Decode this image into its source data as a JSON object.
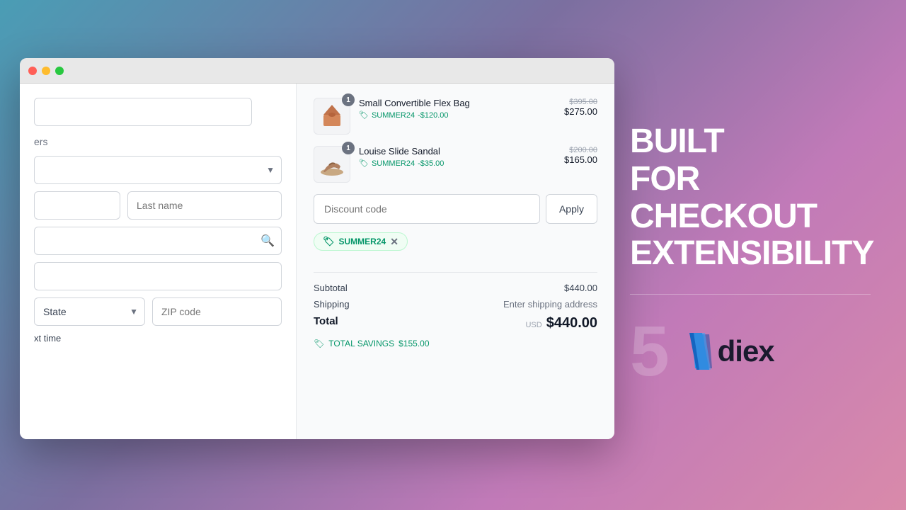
{
  "browser": {
    "traffic_lights": [
      "red",
      "yellow",
      "green"
    ]
  },
  "left_panel": {
    "input_placeholder_1": "",
    "section_label": "ers",
    "dropdown_placeholder": "",
    "first_name_placeholder": "",
    "last_name_placeholder": "Last name",
    "address_placeholder": "",
    "city_placeholder": "",
    "state_label": "State",
    "zip_placeholder": "ZIP code",
    "remember_label": "xt time"
  },
  "right_panel": {
    "items": [
      {
        "name": "Small Convertible Flex Bag",
        "badge": "1",
        "discount_code": "SUMMER24",
        "discount_amount": "-$120.00",
        "original_price": "$395.00",
        "sale_price": "$275.00"
      },
      {
        "name": "Louise Slide Sandal",
        "badge": "1",
        "discount_code": "SUMMER24",
        "discount_amount": "-$35.00",
        "original_price": "$200.00",
        "sale_price": "$165.00"
      }
    ],
    "discount_input_placeholder": "Discount code",
    "apply_button": "Apply",
    "applied_code": "SUMMER24",
    "subtotal_label": "Subtotal",
    "subtotal_value": "$440.00",
    "shipping_label": "Shipping",
    "shipping_value": "Enter shipping address",
    "total_label": "Total",
    "total_currency": "USD",
    "total_value": "$440.00",
    "savings_label": "TOTAL SAVINGS",
    "savings_value": "$155.00"
  },
  "branding": {
    "tagline_line1": "BUILT",
    "tagline_line2": "FOR CHECKOUT",
    "tagline_line3": "EXTENSIBILITY",
    "number": "5",
    "logo_text": "diex"
  }
}
